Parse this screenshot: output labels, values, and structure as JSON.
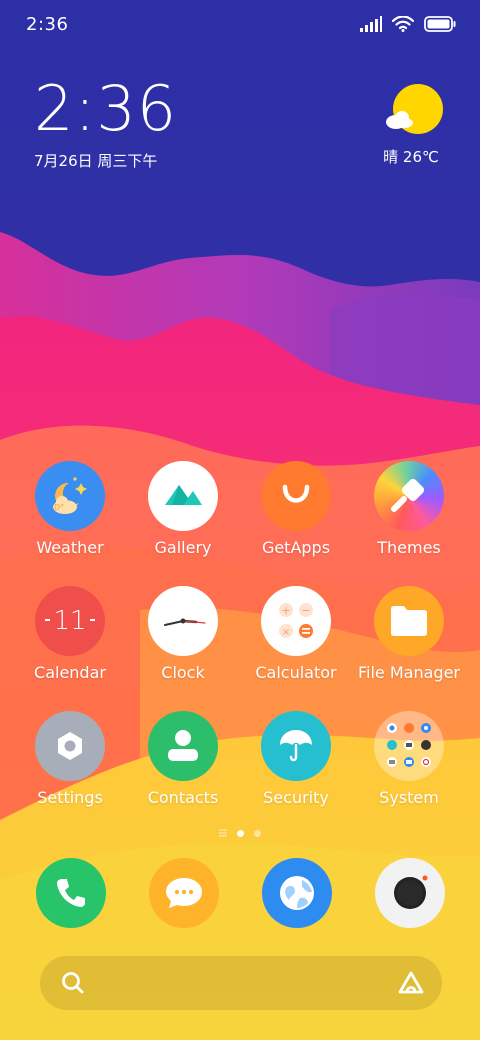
{
  "status_bar": {
    "time": "2:36"
  },
  "widget": {
    "time": "2:36",
    "date": "7月26日 周三下午",
    "weather": "晴 26℃"
  },
  "apps": [
    {
      "label": "Weather",
      "icon": "weather-icon"
    },
    {
      "label": "Gallery",
      "icon": "gallery-icon"
    },
    {
      "label": "GetApps",
      "icon": "getapps-icon"
    },
    {
      "label": "Themes",
      "icon": "themes-icon"
    },
    {
      "label": "Calendar",
      "icon": "calendar-icon",
      "day": "11"
    },
    {
      "label": "Clock",
      "icon": "clock-icon"
    },
    {
      "label": "Calculator",
      "icon": "calculator-icon"
    },
    {
      "label": "File Manager",
      "icon": "file-manager-icon"
    },
    {
      "label": "Settings",
      "icon": "settings-icon"
    },
    {
      "label": "Contacts",
      "icon": "contacts-icon"
    },
    {
      "label": "Security",
      "icon": "security-icon"
    },
    {
      "label": "System",
      "icon": "system-folder-icon"
    }
  ],
  "dock": [
    {
      "icon": "phone-icon"
    },
    {
      "icon": "messages-icon"
    },
    {
      "icon": "browser-icon"
    },
    {
      "icon": "camera-icon"
    }
  ],
  "page_indicator": {
    "pages": 2,
    "current": 1
  },
  "colors": {
    "sky": "#2E2FA5",
    "weather": "#3A8EF2",
    "getapps": "#FF7A2E",
    "calendar_bg": "#F2554E",
    "file_manager": "#FFA726",
    "settings": "#9AA3B0",
    "contacts": "#2DBE6C",
    "security": "#25BFD0",
    "phone": "#27C46A",
    "messages": "#FFB32B",
    "browser": "#2E8CF0"
  }
}
